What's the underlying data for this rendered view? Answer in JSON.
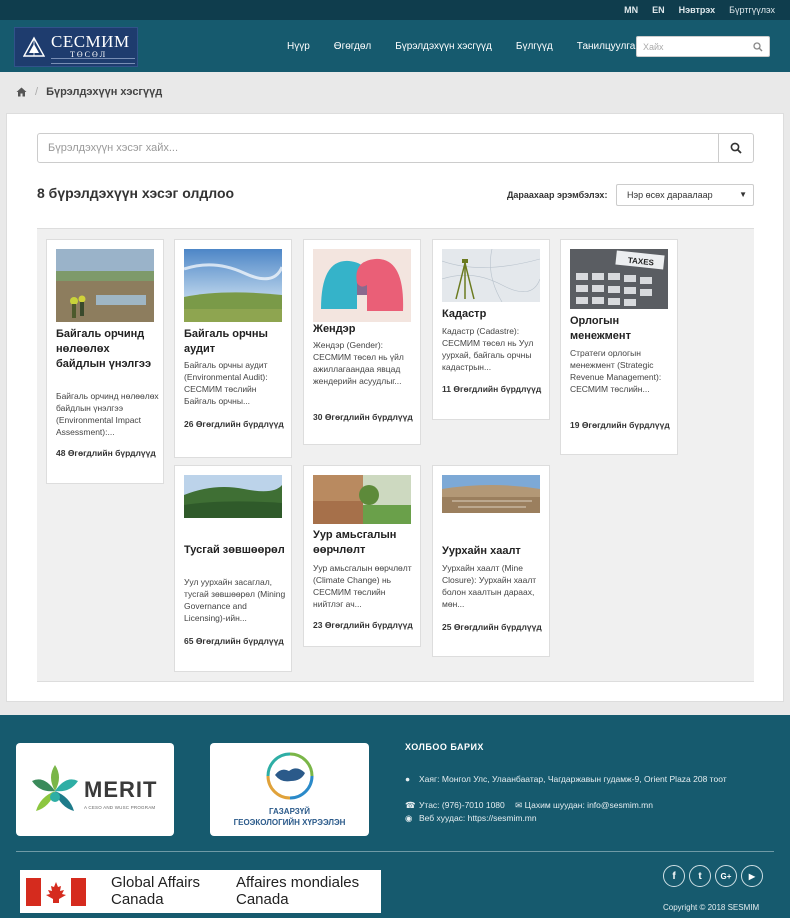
{
  "topbar": {
    "lang_mn": "MN",
    "lang_en": "EN",
    "login": "Нэвтрэх",
    "register": "Бүртгүүлэх"
  },
  "header": {
    "logo_name": "СЕСМИМ",
    "logo_sub": "ТӨСӨЛ",
    "nav": [
      "Нүүр",
      "Өгөгдөл",
      "Бүрэлдэхүүн хэсгүүд",
      "Бүлгүүд",
      "Танилцуулга"
    ],
    "search_placeholder": "Хайх"
  },
  "breadcrumb": {
    "current": "Бүрэлдэхүүн хэсгүүд"
  },
  "main": {
    "search_placeholder": "Бүрэлдэхүүн хэсэг хайх...",
    "results": "8 бүрэлдэхүүн хэсэг олдлоо",
    "sort_label": "Дараахаар эрэмбэлэх:",
    "sort_value": "Нэр өсөх дараалаар",
    "cards": [
      {
        "title": "Байгаль орчинд нөлөөлөх байдлын үнэлгээ",
        "desc": "Байгаль орчинд нөлөөлөх байдлын үнэлгээ (Environmental Impact Assessment):...",
        "count": "48 Өгөгдлийн бүрдлүүд"
      },
      {
        "title": "Байгаль орчны аудит",
        "desc": "Байгаль орчны аудит (Environmental Audit): СЕСМИМ төслийн Байгаль орчны...",
        "count": "26 Өгөгдлийн бүрдлүүд"
      },
      {
        "title": "Жендэр",
        "desc": "Жендэр (Gender): СЕСМИМ төсөл нь үйл ажиллагаандаа явцад жендерийн асуудлыг...",
        "count": "30 Өгөгдлийн бүрдлүүд"
      },
      {
        "title": "Кадастр",
        "desc": "Кадастр (Cadastre): СЕСМИМ төсөл нь Уул уурхай, байгаль орчны кадастрын...",
        "count": "11 Өгөгдлийн бүрдлүүд"
      },
      {
        "title": "Орлогын менежмент",
        "desc": "Стратеги орлогын менежмент (Strategic Revenue Management): СЕСМИМ төслийн...",
        "count": "19 Өгөгдлийн бүрдлүүд",
        "image_text": "TAXES"
      },
      {
        "title": "Тусгай зөвшөөрөл",
        "desc": "Уул уурхайн засаглал, тусгай зөвшөөрөл (Mining Governance and Licensing)-ийн...",
        "count": "65 Өгөгдлийн бүрдлүүд"
      },
      {
        "title": "Уур амьсгалын өөрчлөлт",
        "desc": "Уур амьсгалын өөрчлөлт (Climate Change) нь СЕСМИМ төслийн нийтлэг ач...",
        "count": "23 Өгөгдлийн бүрдлүүд"
      },
      {
        "title": "Уурхайн хаалт",
        "desc": "Уурхайн хаалт (Mine Closure): Уурхайн хаалт болон хаалтын дараах, мөн...",
        "count": "25 Өгөгдлийн бүрдлүүд"
      }
    ]
  },
  "footer": {
    "merit_name": "MERIT",
    "merit_tag": "A CESO AND WUSC PROGRAM",
    "gaz_line1": "ГАЗАРЗҮЙ",
    "gaz_line2": "ГЕОЭКОЛОГИЙН ХҮРЭЭЛЭН",
    "contact_title": "ХОЛБОО БАРИХ",
    "address": "Хаяг: Монгол Улс, Улаанбаатар, Чагдаржавын гудамж-9, Orient Plaza 208 тоот",
    "phone": "Утас: (976)-7010 1080",
    "email": "Цахим шуудан: info@sesmim.mn",
    "web": "Веб хуудас: https://sesmim.mn",
    "gac_en_1": "Global Affairs",
    "gac_en_2": "Canada",
    "gac_fr_1": "Affaires mondiales",
    "gac_fr_2": "Canada",
    "social": [
      "f",
      "t",
      "G+",
      "▶"
    ],
    "copyright": "Copyright © 2018 SESMIM"
  },
  "colors": {
    "topbar": "#0f3d4d",
    "header": "#165a6e",
    "footer": "#165a6e",
    "logo_bg": "#1e3c6e"
  }
}
